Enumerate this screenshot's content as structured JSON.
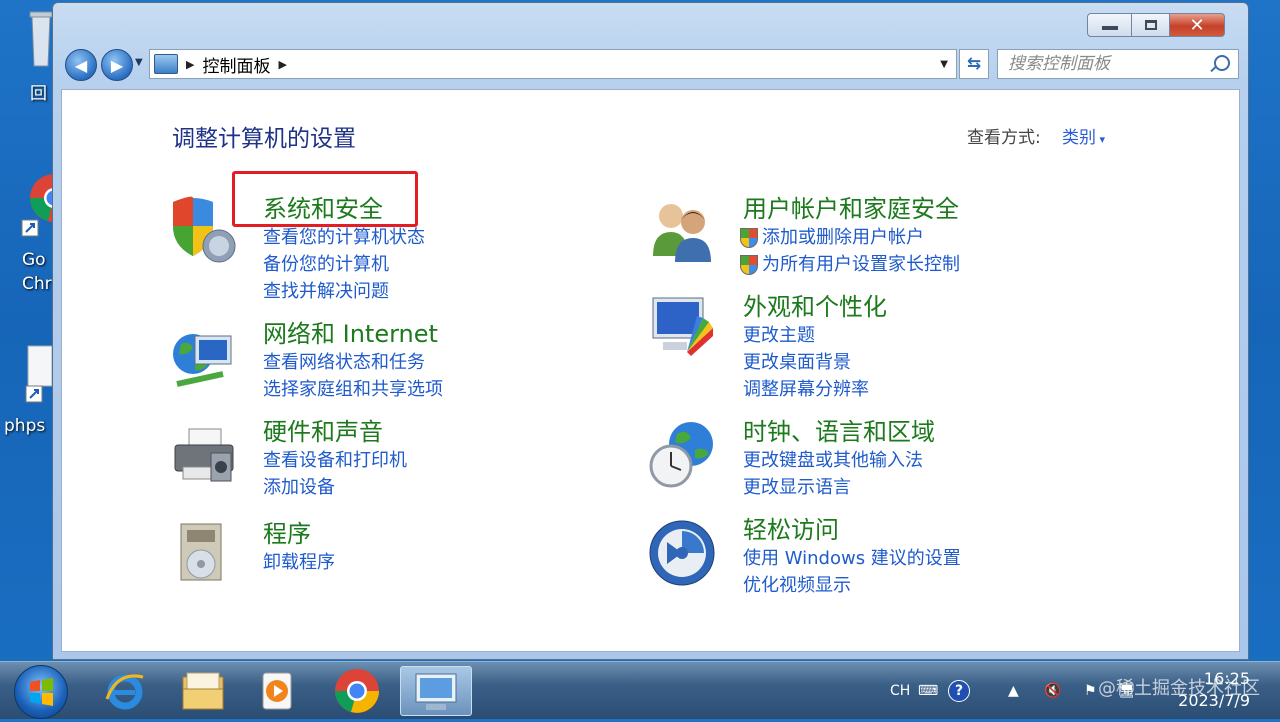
{
  "desktop": {
    "icons": [
      {
        "label": "回"
      },
      {
        "label": "Go"
      },
      {
        "label": "Chr"
      },
      {
        "label": "phps"
      }
    ]
  },
  "window": {
    "controls": {
      "minimize": "—",
      "maximize": "☐",
      "close": "✕"
    },
    "address": {
      "segment": "控制面板"
    },
    "search": {
      "placeholder": "搜索控制面板"
    }
  },
  "content": {
    "title": "调整计算机的设置",
    "view_by_label": "查看方式:",
    "view_by_value": "类别",
    "categories": [
      {
        "title": "系统和安全",
        "links": [
          "查看您的计算机状态",
          "备份您的计算机",
          "查找并解决问题"
        ]
      },
      {
        "title": "网络和 Internet",
        "links": [
          "查看网络状态和任务",
          "选择家庭组和共享选项"
        ]
      },
      {
        "title": "硬件和声音",
        "links": [
          "查看设备和打印机",
          "添加设备"
        ]
      },
      {
        "title": "程序",
        "links": [
          "卸载程序"
        ]
      },
      {
        "title": "用户帐户和家庭安全",
        "links": [
          "添加或删除用户帐户",
          "为所有用户设置家长控制"
        ]
      },
      {
        "title": "外观和个性化",
        "links": [
          "更改主题",
          "更改桌面背景",
          "调整屏幕分辨率"
        ]
      },
      {
        "title": "时钟、语言和区域",
        "links": [
          "更改键盘或其他输入法",
          "更改显示语言"
        ]
      },
      {
        "title": "轻松访问",
        "links": [
          "使用 Windows 建议的设置",
          "优化视频显示"
        ]
      }
    ]
  },
  "taskbar": {
    "tray_lang": "CH",
    "time": "16:25",
    "date": "2023/7/9",
    "watermark": "@稀土掘金技术社区"
  },
  "colors": {
    "category_green": "#1c7a1c",
    "link_blue": "#1f5bcc",
    "highlight_red": "#e21e24",
    "title_blue": "#1e3287"
  }
}
